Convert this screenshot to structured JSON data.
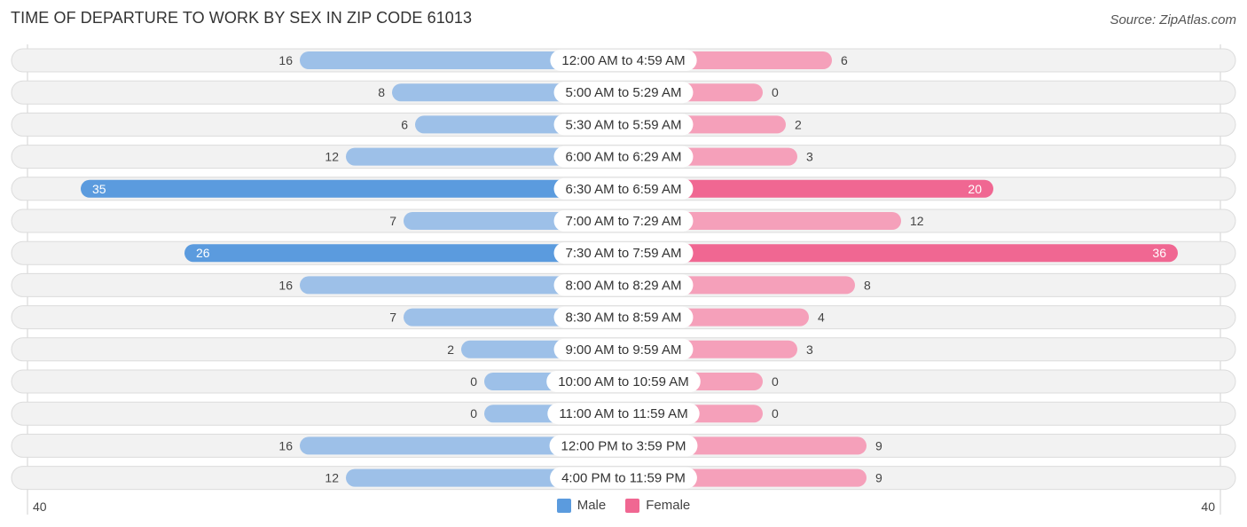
{
  "header": {
    "title": "TIME OF DEPARTURE TO WORK BY SEX IN ZIP CODE 61013",
    "source": "Source: ZipAtlas.com"
  },
  "legend": [
    {
      "name": "Male",
      "color": "#5b9bde"
    },
    {
      "name": "Female",
      "color": "#f06792"
    }
  ],
  "colors": {
    "male_strong": "#5b9bde",
    "male_light": "#9dc0e8",
    "female_strong": "#f06792",
    "female_light": "#f5a0ba",
    "row_bg": "#f2f2f2"
  },
  "chart_data": {
    "type": "bar",
    "orientation": "horizontal-diverging",
    "title": "TIME OF DEPARTURE TO WORK BY SEX IN ZIP CODE 61013",
    "categories": [
      "12:00 AM to 4:59 AM",
      "5:00 AM to 5:29 AM",
      "5:30 AM to 5:59 AM",
      "6:00 AM to 6:29 AM",
      "6:30 AM to 6:59 AM",
      "7:00 AM to 7:29 AM",
      "7:30 AM to 7:59 AM",
      "8:00 AM to 8:29 AM",
      "8:30 AM to 8:59 AM",
      "9:00 AM to 9:59 AM",
      "10:00 AM to 10:59 AM",
      "11:00 AM to 11:59 AM",
      "12:00 PM to 3:59 PM",
      "4:00 PM to 11:59 PM"
    ],
    "series": [
      {
        "name": "Male",
        "values": [
          16,
          8,
          6,
          12,
          35,
          7,
          26,
          16,
          7,
          2,
          0,
          0,
          16,
          12
        ]
      },
      {
        "name": "Female",
        "values": [
          6,
          0,
          2,
          3,
          20,
          12,
          36,
          8,
          4,
          3,
          0,
          0,
          9,
          9
        ]
      }
    ],
    "axis": {
      "left_label": "40",
      "right_label": "40",
      "max": 40
    },
    "legend_position": "bottom-center"
  }
}
